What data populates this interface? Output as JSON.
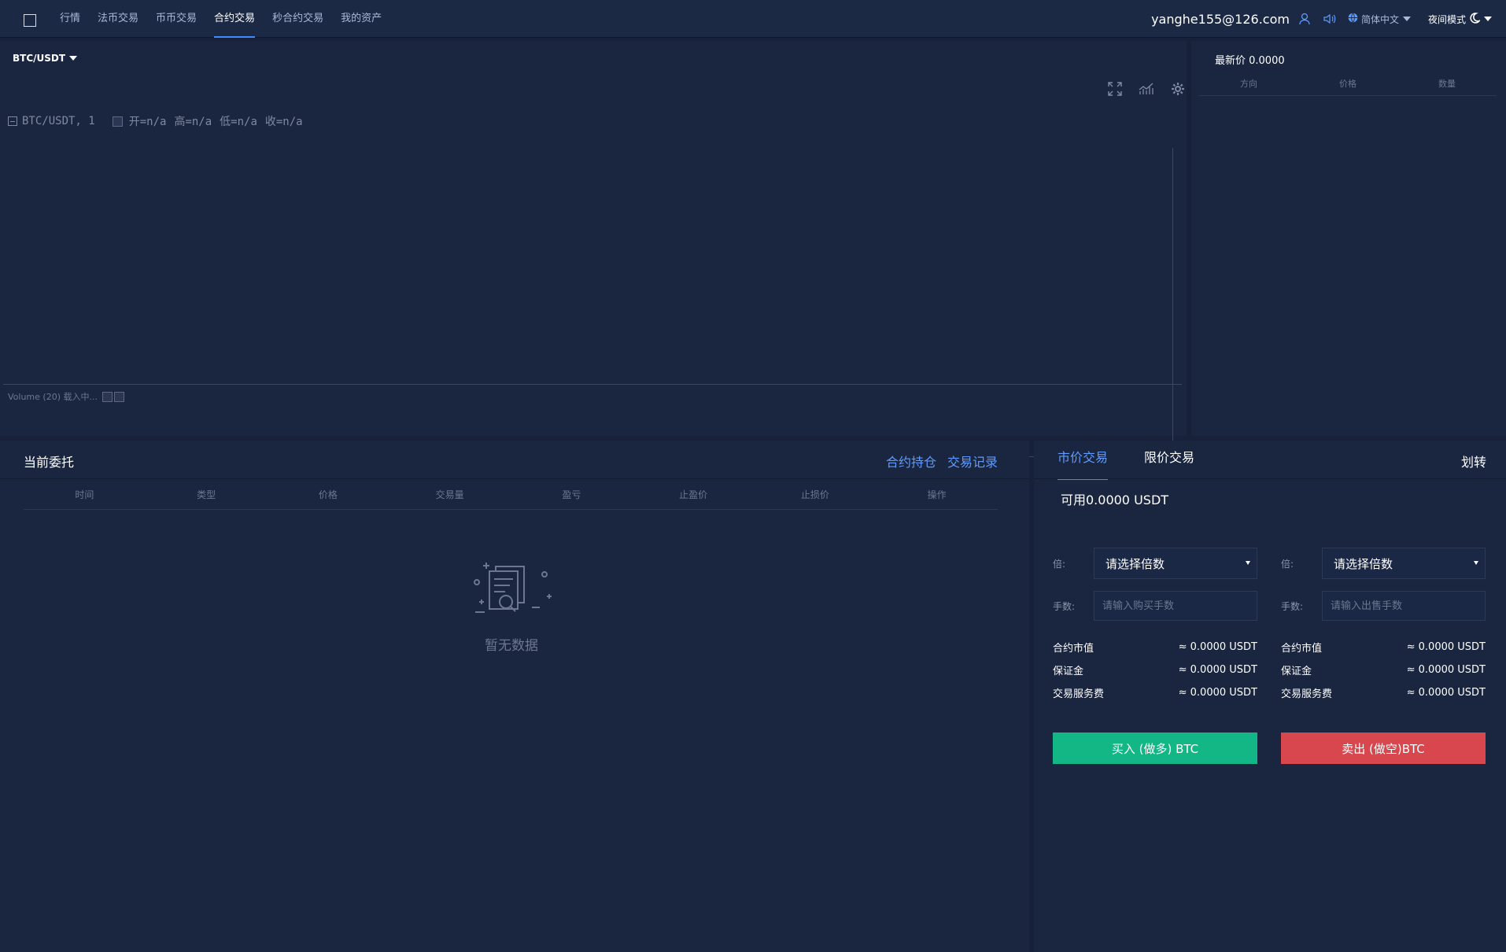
{
  "nav": {
    "items": [
      {
        "label": "行情"
      },
      {
        "label": "法币交易"
      },
      {
        "label": "币币交易"
      },
      {
        "label": "合约交易",
        "active": true
      },
      {
        "label": "秒合约交易"
      },
      {
        "label": "我的资产"
      }
    ]
  },
  "user": {
    "email": "yanghe155@126.com"
  },
  "language": {
    "label": "简体中文"
  },
  "theme": {
    "label": "夜间模式"
  },
  "chart": {
    "pair": "BTC/USDT",
    "legend_symbol": "BTC/USDT, 1",
    "open": "开=n/a",
    "high": "高=n/a",
    "low": "低=n/a",
    "close": "收=n/a",
    "volume_legend": "Volume (20) 载入中..."
  },
  "orderbook": {
    "title": "最新价 0.0000",
    "columns": [
      "方向",
      "价格",
      "数量"
    ]
  },
  "orders": {
    "title": "当前委托",
    "links": [
      "合约持仓",
      "交易记录"
    ],
    "columns": [
      "时间",
      "类型",
      "价格",
      "交易量",
      "盈亏",
      "止盈价",
      "止损价",
      "操作"
    ],
    "empty_text": "暂无数据"
  },
  "trade": {
    "tabs": [
      "市价交易",
      "限价交易"
    ],
    "transfer_label": "划转",
    "available": "可用0.0000 USDT",
    "multiplier_label": "倍:",
    "lots_label": "手数:",
    "buy": {
      "multiplier_value": "请选择倍数",
      "lots_placeholder": "请输入购买手数",
      "stats": [
        {
          "label": "合约市值",
          "value": "≈ 0.0000 USDT"
        },
        {
          "label": "保证金",
          "value": "≈ 0.0000 USDT"
        },
        {
          "label": "交易服务费",
          "value": "≈ 0.0000 USDT"
        }
      ],
      "button_label": "买入 (做多) BTC"
    },
    "sell": {
      "multiplier_value": "请选择倍数",
      "lots_placeholder": "请输入出售手数",
      "stats": [
        {
          "label": "合约市值",
          "value": "≈ 0.0000 USDT"
        },
        {
          "label": "保证金",
          "value": "≈ 0.0000 USDT"
        },
        {
          "label": "交易服务费",
          "value": "≈ 0.0000 USDT"
        }
      ],
      "button_label": "卖出 (做空)BTC"
    }
  },
  "colors": {
    "background": "#17223a",
    "panel": "#1a2640",
    "accent": "#3f8cff",
    "buy": "#13b685",
    "sell": "#d8464e"
  }
}
